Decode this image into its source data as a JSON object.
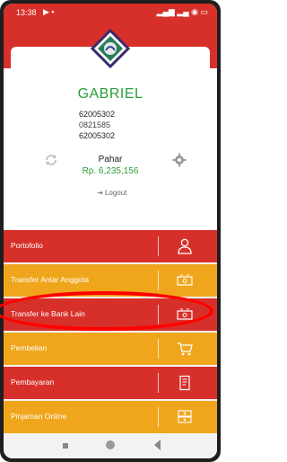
{
  "status_bar": {
    "time": "13:38"
  },
  "profile": {
    "name": "GABRIEL",
    "accounts": [
      "62005302",
      "0821585",
      "62005302"
    ],
    "holder": "Pahar",
    "balance": "Rp. 6,235,156",
    "logout_label": "Logout"
  },
  "menu": {
    "items": [
      {
        "label": "Portofolio",
        "icon": "user-icon",
        "color": "#d7302a"
      },
      {
        "label": "Transfer Antar Anggota",
        "icon": "money-icon",
        "color": "#f0a61c"
      },
      {
        "label": "Transfer ke Bank Lain",
        "icon": "money-icon",
        "color": "#d7302a"
      },
      {
        "label": "Pembelian",
        "icon": "cart-icon",
        "color": "#f0a61c"
      },
      {
        "label": "Pembayaran",
        "icon": "receipt-icon",
        "color": "#d7302a"
      },
      {
        "label": "Pinjaman Online",
        "icon": "cash-stack-icon",
        "color": "#f0a61c"
      }
    ]
  },
  "colors": {
    "red": "#d7302a",
    "orange": "#f0a61c",
    "green": "#2a9d3c",
    "highlight": "#ff0000"
  }
}
